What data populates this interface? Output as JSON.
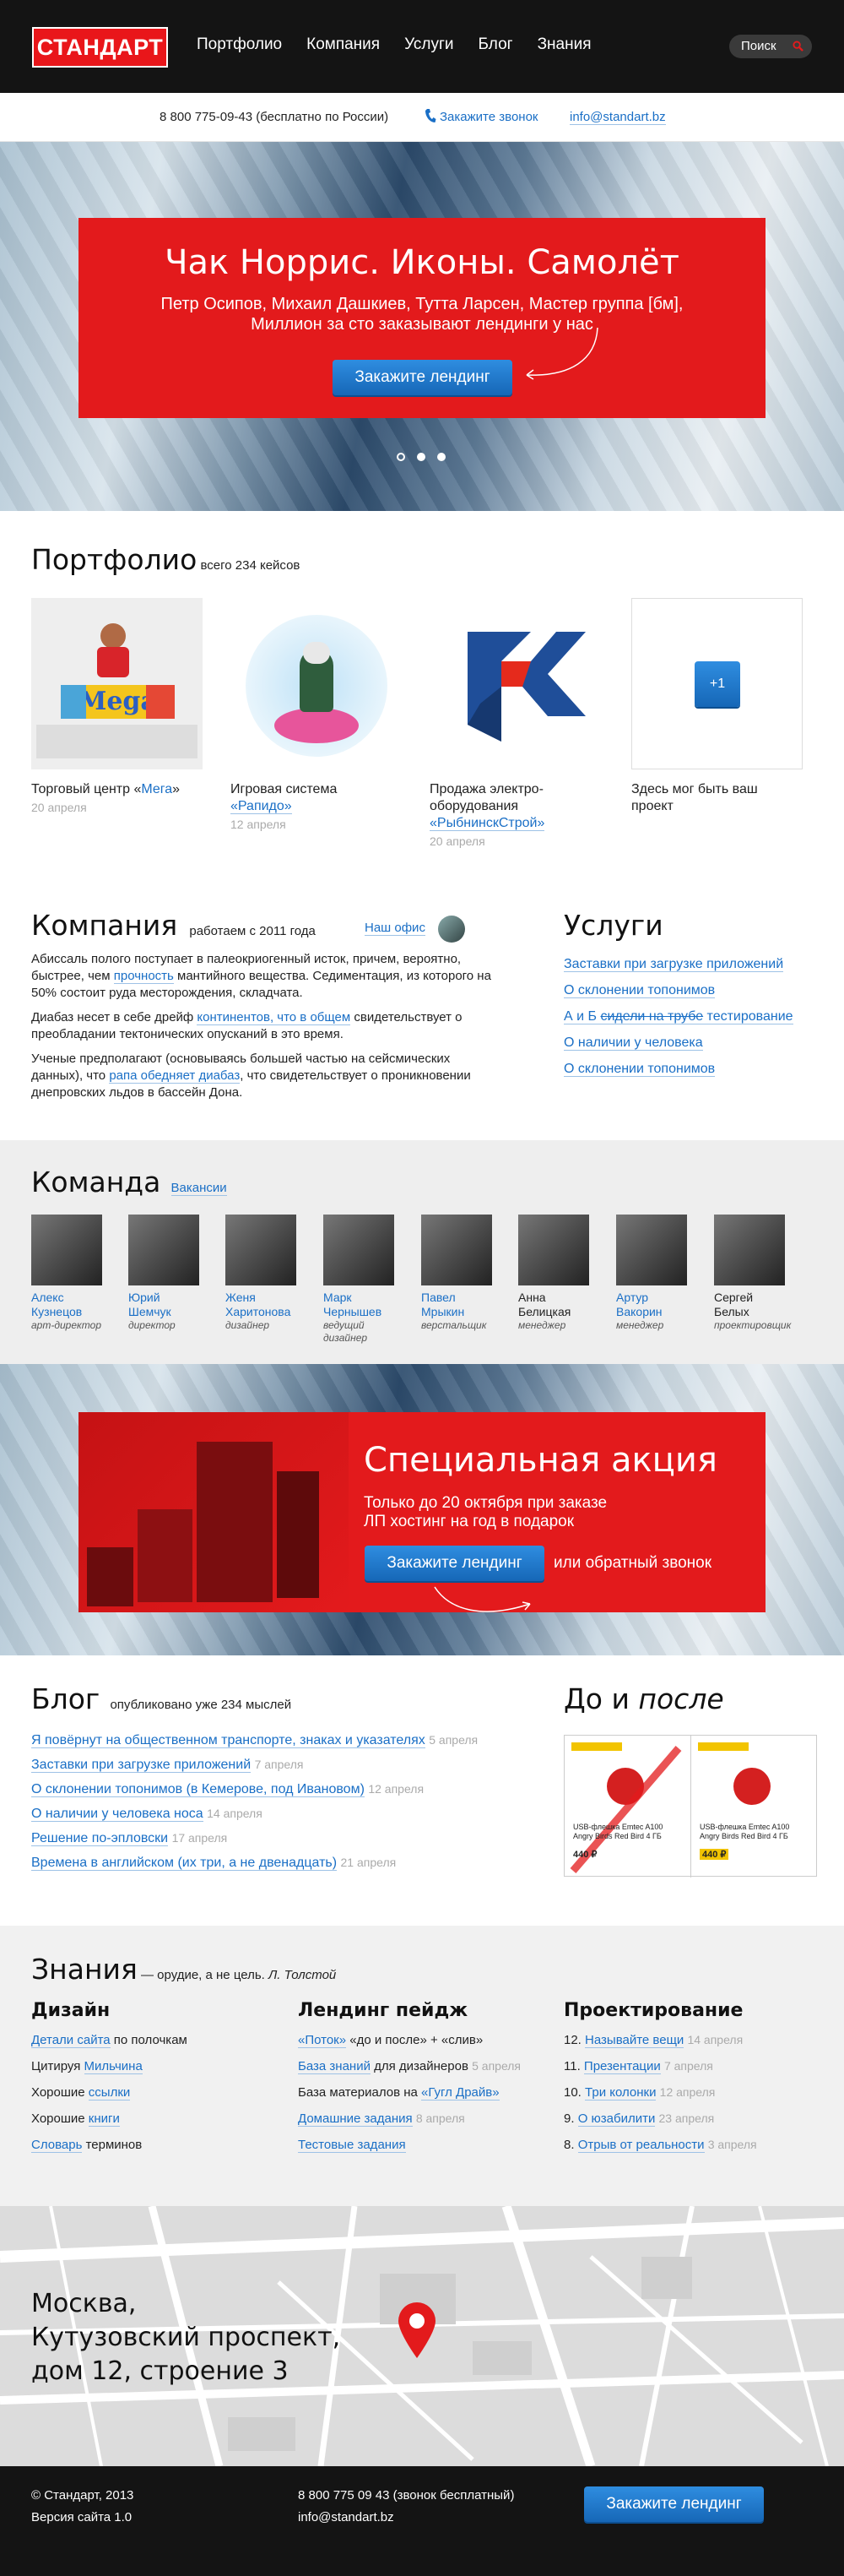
{
  "header": {
    "logo": "СТАНДАРТ",
    "nav": [
      "Портфолио",
      "Компания",
      "Услуги",
      "Блог",
      "Знания"
    ],
    "search_label": "Поиск"
  },
  "contacts": {
    "phone": "8 800 775-09-43 (бесплатно по России)",
    "callback": "Закажите звонок",
    "email": "info@standart.bz"
  },
  "hero": {
    "title": "Чак Норрис. Иконы. Самолёт",
    "line1": "Петр Осипов, Михаил Дашкиев, Тутта Ларсен, Мастер группа [бм],",
    "line2": "Миллион за сто заказывают лендинги у нас",
    "button": "Закажите лендинг"
  },
  "portfolio": {
    "title": "Портфолио",
    "count": "всего 234 кейсов",
    "items": [
      {
        "pre": "Торговый центр «",
        "link": "Мега",
        "post": "»",
        "date": "20 апреля"
      },
      {
        "pre": "Игровая система ",
        "link": "«Рапидо»",
        "post": "",
        "date": "12 апреля"
      },
      {
        "pre": "Продажа электро-оборудования ",
        "link": "«РыбнинскСтрой»",
        "post": "",
        "date": "20 апреля"
      },
      {
        "pre": "Здесь мог быть ваш проект",
        "link": "",
        "post": "",
        "date": ""
      }
    ],
    "plus_label": "+1",
    "mega_logo": "Mega"
  },
  "company": {
    "title": "Компания",
    "since": "работаем с 2011 года",
    "office": "Наш офис",
    "p1_a": "Абиссаль полого поступает в палеокриогенный исток, причем, вероятно, быстрее, чем ",
    "p1_link": "прочность",
    "p1_b": " мантийного вещества. Седиментация, из которого на 50% состоит руда месторождения, складчата.",
    "p2_a": "Диабаз несет в себе дрейф ",
    "p2_link": "континентов, что в общем",
    "p2_b": " свидетельствует о преобладании тектонических опусканий в это время.",
    "p3_a": "Ученые предполагают (основываясь большей частью на сейсмических данных), что ",
    "p3_link": "рапа обедняет диабаз",
    "p3_b": ", что свидетельствует о проникновении днепровских льдов в бассейн Дона."
  },
  "services": {
    "title": "Услуги",
    "items": [
      "Заставки при загрузке приложений",
      "О склонении топонимов",
      "А и Б ",
      "сидели на трубе",
      " тестирование",
      "О наличии у человека",
      "О склонении топонимов"
    ]
  },
  "team": {
    "title": "Команда",
    "vacancies": "Вакансии",
    "members": [
      {
        "name": "Алекс Кузнецов",
        "role": "арт-директор"
      },
      {
        "name": "Юрий Шемчук",
        "role": "директор"
      },
      {
        "name": "Женя Харитонова",
        "role": "дизайнер"
      },
      {
        "name": "Марк Чернышев",
        "role": "ведущий дизайнер"
      },
      {
        "name": "Павел Мрыкин",
        "role": "верстальщик"
      },
      {
        "name": "Анна Белицкая",
        "role": "менеджер"
      },
      {
        "name": "Артур Вакорин",
        "role": "менеджер"
      },
      {
        "name": "Сергей Белых",
        "role": "проектировщик"
      }
    ]
  },
  "promo": {
    "title": "Специальная акция",
    "line1": "Только до 20 октября при заказе",
    "line2": "ЛП хостинг на год в подарок",
    "button": "Закажите лендинг",
    "alt": "или обратный звонок"
  },
  "blog": {
    "title": "Блог",
    "count": "опубликовано уже 234 мыслей",
    "posts": [
      {
        "title": "Я повёрнут на общественном транспорте, знаках и указателях",
        "date": "5 апреля"
      },
      {
        "title": "Заставки при загрузке приложений",
        "date": "7 апреля"
      },
      {
        "title": "О склонении топонимов (в Кемерове, под Ивановом)",
        "date": "12 апреля"
      },
      {
        "title": "О наличии у человека носа",
        "date": "14 апреля"
      },
      {
        "title": "Решение по-эпловски",
        "date": "17 апреля"
      },
      {
        "title": "Времена в английском (их три, а не двенадцать)",
        "date": "21 апреля"
      }
    ]
  },
  "before_after": {
    "title_a": "До и ",
    "title_b": "после",
    "card_text": "USB-флешка Emtec A100 Angry Birds Red Bird 4 ГБ",
    "price": "440 ₽"
  },
  "knowledge": {
    "title": "Знания",
    "quote": "— орудие, а не цель.",
    "author": "Л. Толстой",
    "design": {
      "title": "Дизайн",
      "lines": [
        {
          "link": "Детали сайта",
          "text": " по полочкам"
        },
        {
          "pre": "Цитируя ",
          "link": "Мильчина"
        },
        {
          "pre": "Хорошие ",
          "link": "ссылки"
        },
        {
          "pre": "Хорошие ",
          "link": "книги"
        },
        {
          "link": "Словарь",
          "text": " терминов"
        }
      ]
    },
    "landing": {
      "title": "Лендинг пейдж",
      "l1_link": "«Поток»",
      "l1_text": " «до и после» + «слив»",
      "l2_link": "База знаний",
      "l2_text": " для дизайнеров",
      "l2_date": "5 апреля",
      "l3_text": "База материалов на ",
      "l3_link": "«Гугл Драйв»",
      "l4_link": "Домашние задания",
      "l4_date": "8 апреля",
      "l5_link": "Тестовые задания"
    },
    "design2": {
      "title": "Проектирование",
      "items": [
        {
          "num": "12.",
          "link": "Называйте вещи",
          "date": "14 апреля"
        },
        {
          "num": "11.",
          "link": "Презентации",
          "date": "7 апреля"
        },
        {
          "num": "10.",
          "link": "Три колонки",
          "date": "12 апреля"
        },
        {
          "num": "9.",
          "link": "О юзабилити",
          "date": "23 апреля"
        },
        {
          "num": "8.",
          "link": "Отрыв от реальности",
          "date": "3 апреля"
        }
      ]
    }
  },
  "map": {
    "line1": "Москва,",
    "line2": "Кутузовский проспект,",
    "line3": "дом 12, строение 3"
  },
  "footer": {
    "copyright": "© Стандарт, 2013",
    "version": "Версия сайта 1.0",
    "phone": "8 800 775 09 43 (звонок бесплатный)",
    "email": "info@standart.bz",
    "button": "Закажите лендинг"
  },
  "colors": {
    "brand_red": "#e31a1c",
    "link_blue": "#1a6fc6",
    "dark": "#141414"
  }
}
